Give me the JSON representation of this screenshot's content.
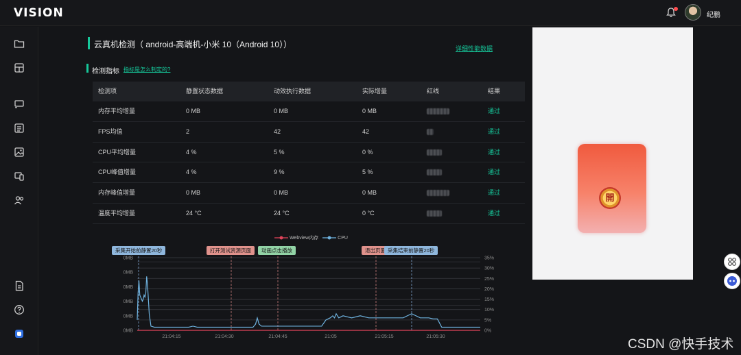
{
  "app": {
    "logo_main": "VISION",
    "username": "纪鹏"
  },
  "header": {
    "title": "云真机检测（ android-高端机-小米 10（Android 10））",
    "detail_link": "详细性能数据",
    "section_title": "检测指标",
    "section_link": "指标是怎么制定的?"
  },
  "table": {
    "columns": [
      "检测项",
      "静置状态数据",
      "动效执行数据",
      "实际增量",
      "红线",
      "结果"
    ],
    "rows": [
      {
        "item": "内存平均增量",
        "idle": "0 MB",
        "anim": "0 MB",
        "delta": "0 MB",
        "result": "通过"
      },
      {
        "item": "FPS均值",
        "idle": "2",
        "anim": "42",
        "delta": "42",
        "result": "通过"
      },
      {
        "item": "CPU平均增量",
        "idle": "4 %",
        "anim": "5 %",
        "delta": "0 %",
        "result": "通过"
      },
      {
        "item": "CPU峰值增量",
        "idle": "4 %",
        "anim": "9 %",
        "delta": "5 %",
        "result": "通过"
      },
      {
        "item": "内存峰值增量",
        "idle": "0 MB",
        "anim": "0 MB",
        "delta": "0 MB",
        "result": "通过"
      },
      {
        "item": "温度平均增量",
        "idle": "24 °C",
        "anim": "24 °C",
        "delta": "0 °C",
        "result": "通过"
      }
    ]
  },
  "chart_data": {
    "type": "line",
    "series": [
      {
        "name": "Webview内存",
        "color": "#e0445a",
        "axis": "left",
        "x": [
          0,
          100
        ],
        "values": [
          0,
          0
        ]
      },
      {
        "name": "CPU",
        "color": "#6fb3e0",
        "axis": "right",
        "x": [
          0,
          1,
          2,
          3,
          5,
          6,
          7,
          8,
          9,
          10,
          11,
          12,
          14,
          16,
          20,
          25,
          30,
          32,
          34,
          36,
          40,
          45,
          50,
          55,
          60,
          65,
          70,
          75,
          80,
          85,
          90,
          95,
          100,
          105,
          110,
          115,
          120,
          125,
          130,
          135,
          138,
          140,
          142,
          145,
          150,
          155,
          160,
          165,
          170,
          180,
          190,
          200,
          210,
          215,
          220,
          225,
          228,
          230,
          232,
          235,
          240,
          250,
          260,
          270,
          280,
          290,
          300,
          310,
          320,
          330,
          335,
          340,
          345,
          350,
          355,
          360,
          365,
          370,
          375,
          380,
          385,
          390,
          400
        ],
        "values": [
          5,
          18,
          24,
          17,
          15,
          14,
          15,
          17,
          16,
          18,
          26,
          22,
          8,
          2,
          1.5,
          1.5,
          1.5,
          1.5,
          1.5,
          1.5,
          1.5,
          1.5,
          1.5,
          1.5,
          1.5,
          2,
          1.5,
          1.5,
          1.5,
          1.5,
          1.5,
          1.5,
          1.5,
          1.5,
          1.5,
          1.5,
          1.5,
          1.5,
          1.5,
          1.5,
          3,
          6,
          3,
          2,
          2,
          2,
          2,
          2,
          2,
          2,
          2,
          2,
          2,
          2,
          5,
          6,
          7,
          6,
          8,
          6,
          7,
          6,
          7,
          6,
          6,
          6,
          6,
          6,
          8,
          6,
          6,
          6,
          5.5,
          5.5,
          1.5,
          1.5,
          1.5,
          1.5,
          1.5,
          1.5,
          1.5,
          1.5,
          1.5
        ]
      }
    ],
    "x_ticks": [
      "21:04:15",
      "21:04:30",
      "21:04:45",
      "21:05",
      "21:05:15",
      "21:05:30"
    ],
    "y_left_ticks": [
      "0MB",
      "0MB",
      "0MB",
      "0MB",
      "0MB",
      "0MB"
    ],
    "y_right_ticks": [
      "0%",
      "5%",
      "10%",
      "15%",
      "20%",
      "25%",
      "30%",
      "35%"
    ],
    "y_right_range": [
      0,
      35
    ],
    "markers": [
      {
        "label": "采集开始前静置20秒",
        "color": "#8fb7dd",
        "line_color": "#7fa4cf"
      },
      {
        "label": "打开测试资源页面",
        "color": "#e0928c",
        "line_color": "#c97b7b"
      },
      {
        "label": "动画点击播放",
        "color": "#92d3a6",
        "line_color": "#c97b7b"
      },
      {
        "label": "退出页面",
        "color": "#e0928c",
        "line_color": "#c97b7b"
      },
      {
        "label": "采集结束前静置20秒",
        "color": "#8fb7dd",
        "line_color": "#7fa4cf"
      }
    ],
    "legend_position": "top-center",
    "grid": true
  },
  "preview": {
    "seal_char": "開"
  },
  "watermark": "CSDN @快手技术",
  "colors": {
    "accent": "#16c79a",
    "background": "#141518"
  }
}
